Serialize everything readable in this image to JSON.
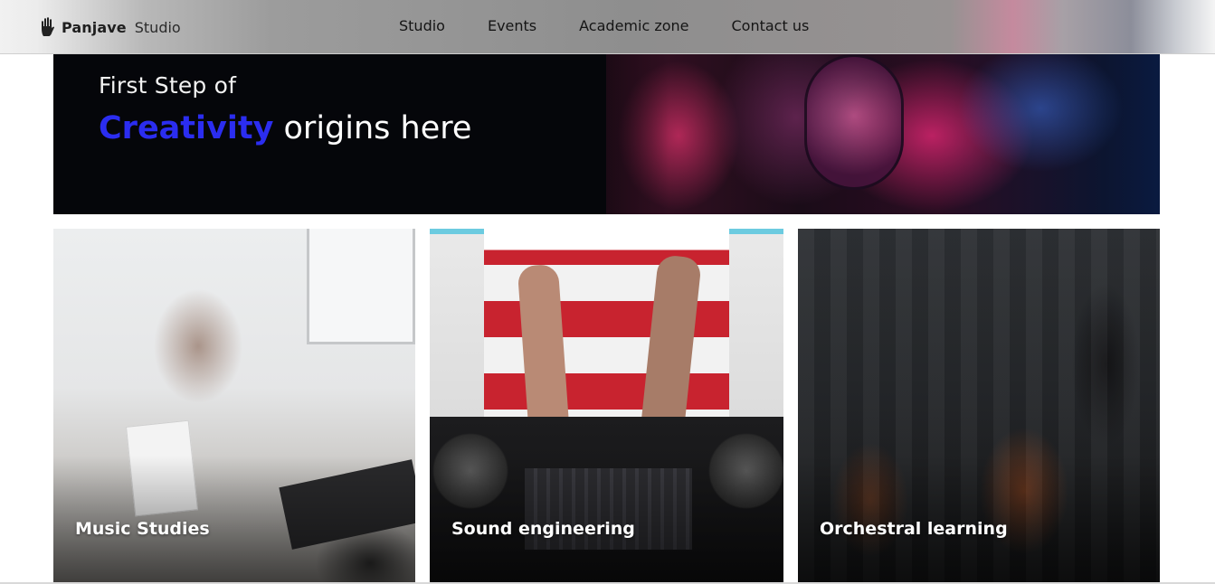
{
  "navbar": {
    "brand_name": "Panjave",
    "brand_suffix": "Studio",
    "brand_icon": "hand-icon",
    "links": [
      {
        "label": "Studio"
      },
      {
        "label": "Events"
      },
      {
        "label": "Academic zone"
      },
      {
        "label": "Contact us"
      }
    ]
  },
  "hero": {
    "line1": "First Step of",
    "accent": "Creativity",
    "rest": " origins here",
    "accent_color": "#2b2df0"
  },
  "cards": [
    {
      "title": "Music Studies"
    },
    {
      "title": "Sound engineering"
    },
    {
      "title": "Orchestral learning"
    }
  ]
}
